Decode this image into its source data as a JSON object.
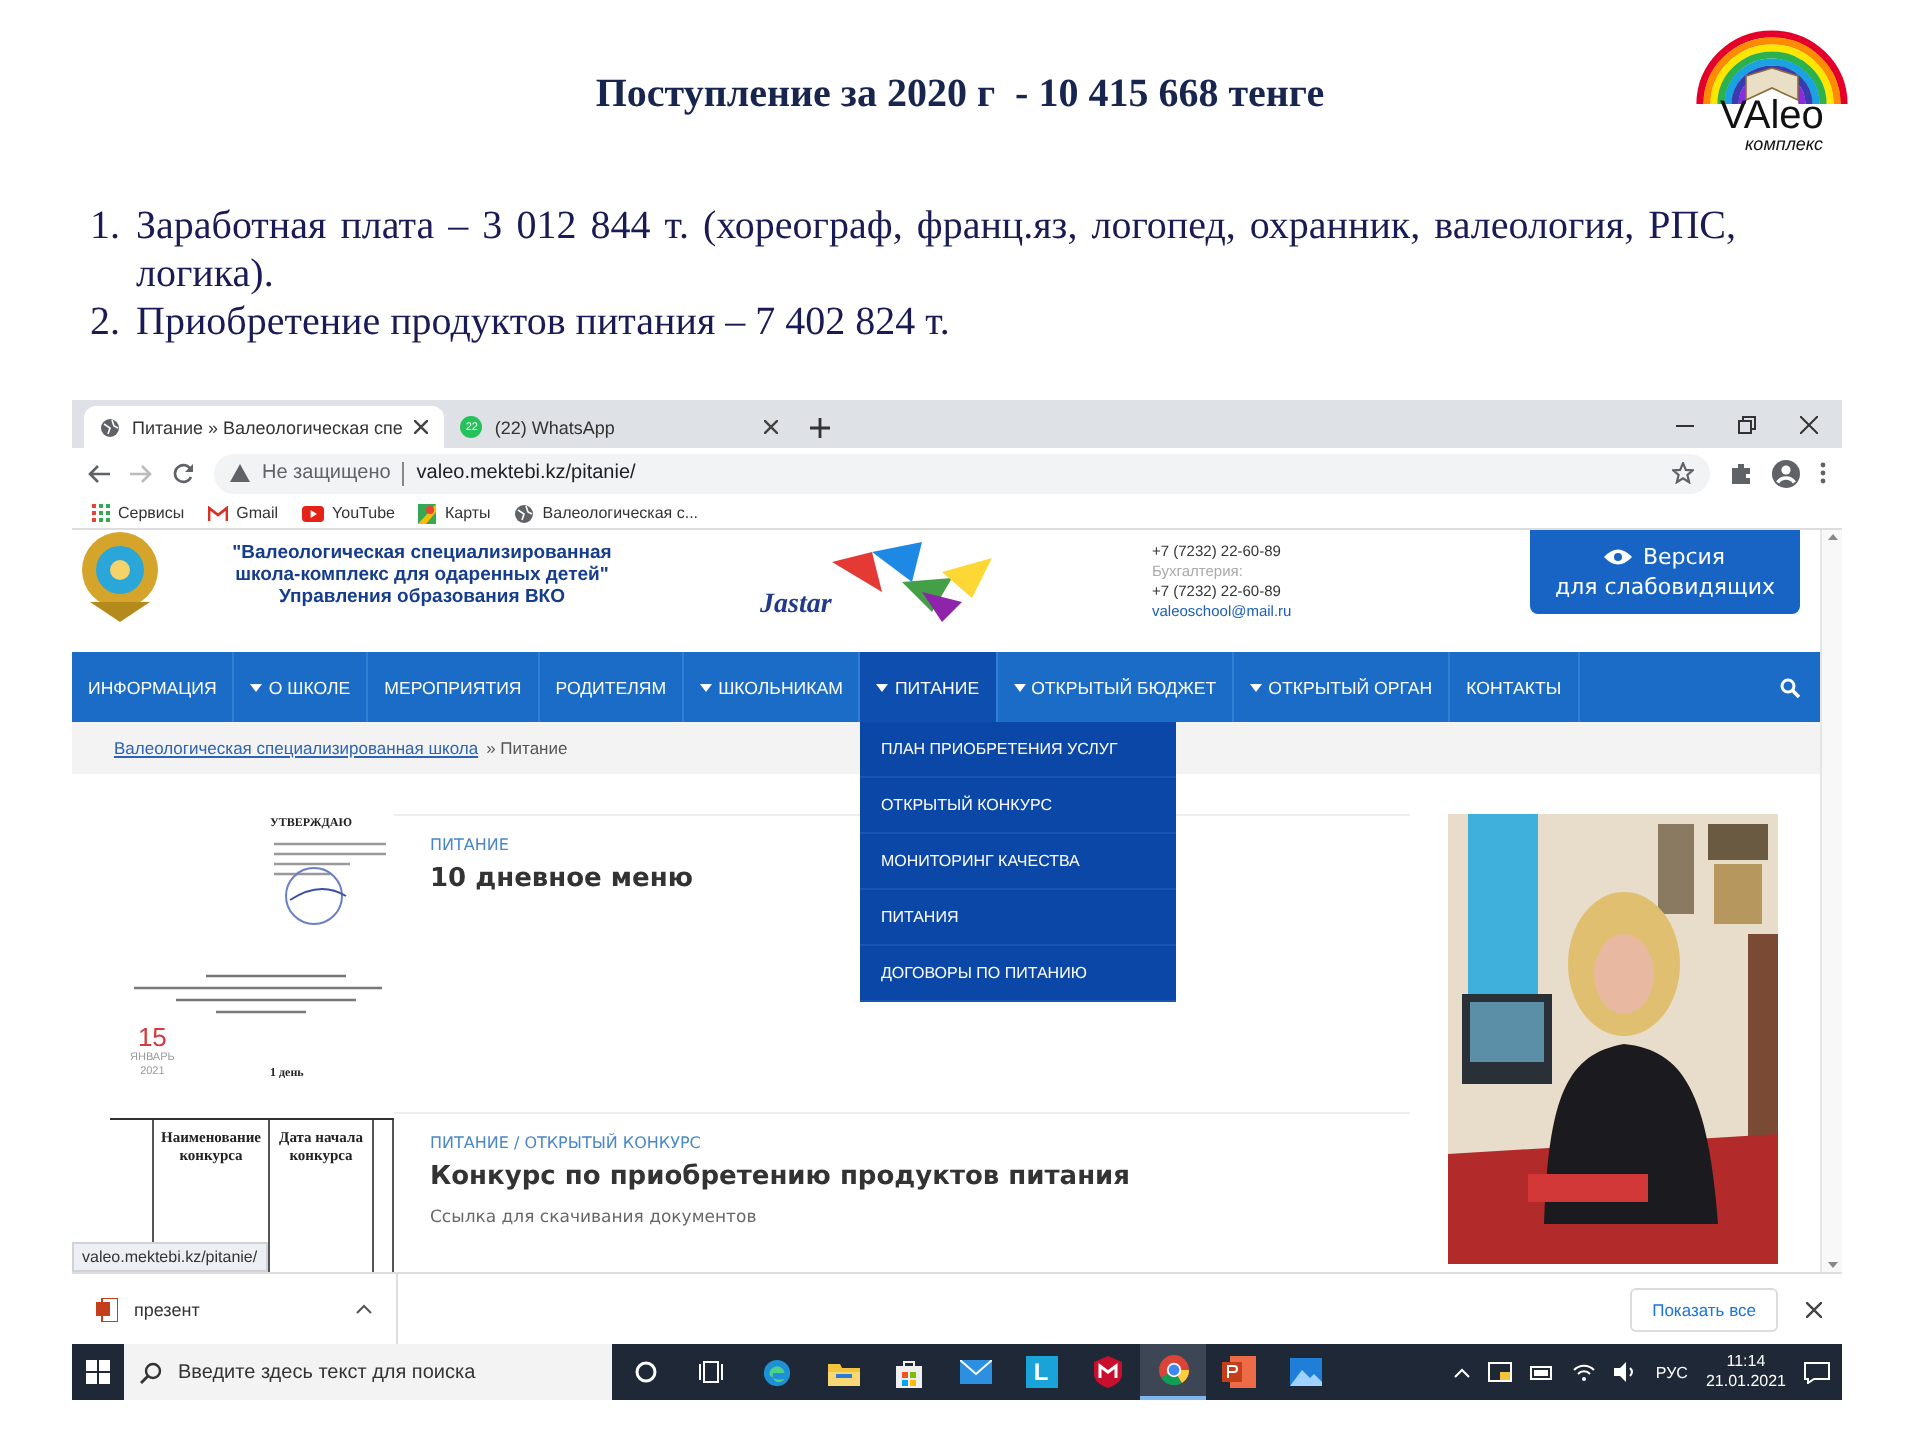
{
  "slide": {
    "title": "Поступление за 2020 г  - 10 415 668 тенге",
    "logo": {
      "word": "VAleo",
      "caption": "комплекс"
    },
    "items": [
      {
        "number": "1.",
        "text": "Заработная плата – 3 012 844 т. (хореограф, франц.яз, логопед, охранник, валеология, РПС, логика)."
      },
      {
        "number": "2.",
        "text": "Приобретение продуктов питания – 7 402 824 т."
      }
    ]
  },
  "browser": {
    "tabs": [
      {
        "title": "Питание » Валеологическая спе",
        "kind": "globe",
        "selected": true
      },
      {
        "title": "(22) WhatsApp",
        "kind": "badge",
        "favicon_text": "22",
        "selected": false
      }
    ],
    "address_bar": {
      "security": "Не защищено",
      "url": "valeo.mektebi.kz/pitanie/"
    },
    "bookmarks": [
      {
        "label": "Сервисы",
        "kind": "apps"
      },
      {
        "label": "Gmail",
        "kind": "gmail"
      },
      {
        "label": "YouTube",
        "kind": "youtube"
      },
      {
        "label": "Карты",
        "kind": "maps"
      },
      {
        "label": "Валеологическая с...",
        "kind": "globe"
      }
    ],
    "page": {
      "org_lines": [
        "\"Валеологическая специализированная",
        "школа-комплекс для одаренных детей\"",
        "Управления образования ВКО"
      ],
      "event_logo": "Jastar",
      "contacts": [
        {
          "kind": "phone",
          "text": "+7 (7232) 22-60-89"
        },
        {
          "kind": "label",
          "text": "Бухгалтерия:"
        },
        {
          "kind": "phone",
          "text": "+7 (7232) 22-60-89"
        },
        {
          "kind": "email",
          "text": "valeoschool@mail.ru"
        }
      ],
      "accessibility_button": [
        "Версия",
        "для слабовидящих"
      ],
      "nav": [
        {
          "label": "ИНФОРМАЦИЯ",
          "dropdown": false,
          "selected": false
        },
        {
          "label": "О ШКОЛЕ",
          "dropdown": true,
          "selected": false
        },
        {
          "label": "МЕРОПРИЯТИЯ",
          "dropdown": false,
          "selected": false
        },
        {
          "label": "РОДИТЕЛЯМ",
          "dropdown": false,
          "selected": false
        },
        {
          "label": "ШКОЛЬНИКАМ",
          "dropdown": true,
          "selected": false
        },
        {
          "label": "ПИТАНИЕ",
          "dropdown": true,
          "selected": true,
          "menu": [
            "ПЛАН ПРИОБРЕТЕНИЯ УСЛУГ",
            "ОТКРЫТЫЙ КОНКУРС",
            "МОНИТОРИНГ КАЧЕСТВА",
            "ПИТАНИЯ",
            "ДОГОВОРЫ ПО ПИТАНИЮ"
          ]
        },
        {
          "label": "ОТКРЫТЫЙ БЮДЖЕТ",
          "dropdown": true,
          "selected": false
        },
        {
          "label": "ОТКРЫТЫЙ ОРГАН",
          "dropdown": true,
          "selected": false
        },
        {
          "label": "КОНТАКТЫ",
          "dropdown": false,
          "selected": false
        }
      ],
      "breadcrumb": {
        "link": "Валеологическая специализированная школа",
        "current": "» Питание"
      },
      "posts": [
        {
          "category": "ПИТАНИЕ",
          "title": "10 дневное меню",
          "thumbnail": {
            "kind": "order",
            "heading": "УТВЕРЖДАЮ",
            "footer": "1 день",
            "date": {
              "day": "15",
              "month": "ЯНВАРЬ",
              "year": "2021"
            }
          }
        },
        {
          "category": "ПИТАНИЕ / ОТКРЫТЫЙ КОНКУРС",
          "title": "Конкурс по приобретению продуктов питания",
          "excerpt": "Ссылка для скачивания документов",
          "thumbnail": {
            "kind": "table",
            "headers": [
              "Наименование конкурса",
              "Дата начала конкурса"
            ]
          }
        }
      ]
    },
    "status_url": "valeo.mektebi.kz/pitanie/",
    "downloads": {
      "file": "презент",
      "show_all": "Показать все"
    }
  },
  "taskbar": {
    "search_placeholder": "Введите здесь текст для поиска",
    "apps": [
      {
        "kind": "cortana",
        "selected": false
      },
      {
        "kind": "taskview",
        "selected": false
      },
      {
        "kind": "edge",
        "selected": false
      },
      {
        "kind": "explorer",
        "selected": false
      },
      {
        "kind": "store",
        "selected": false
      },
      {
        "kind": "mail",
        "selected": false
      },
      {
        "kind": "letter",
        "glyph": "L",
        "selected": false
      },
      {
        "kind": "shield",
        "selected": false
      },
      {
        "kind": "chrome",
        "selected": true
      },
      {
        "kind": "powerpoint",
        "selected": false
      },
      {
        "kind": "photos",
        "selected": false
      }
    ],
    "language": "РУС",
    "time": "11:14",
    "date": "21.01.2021"
  }
}
